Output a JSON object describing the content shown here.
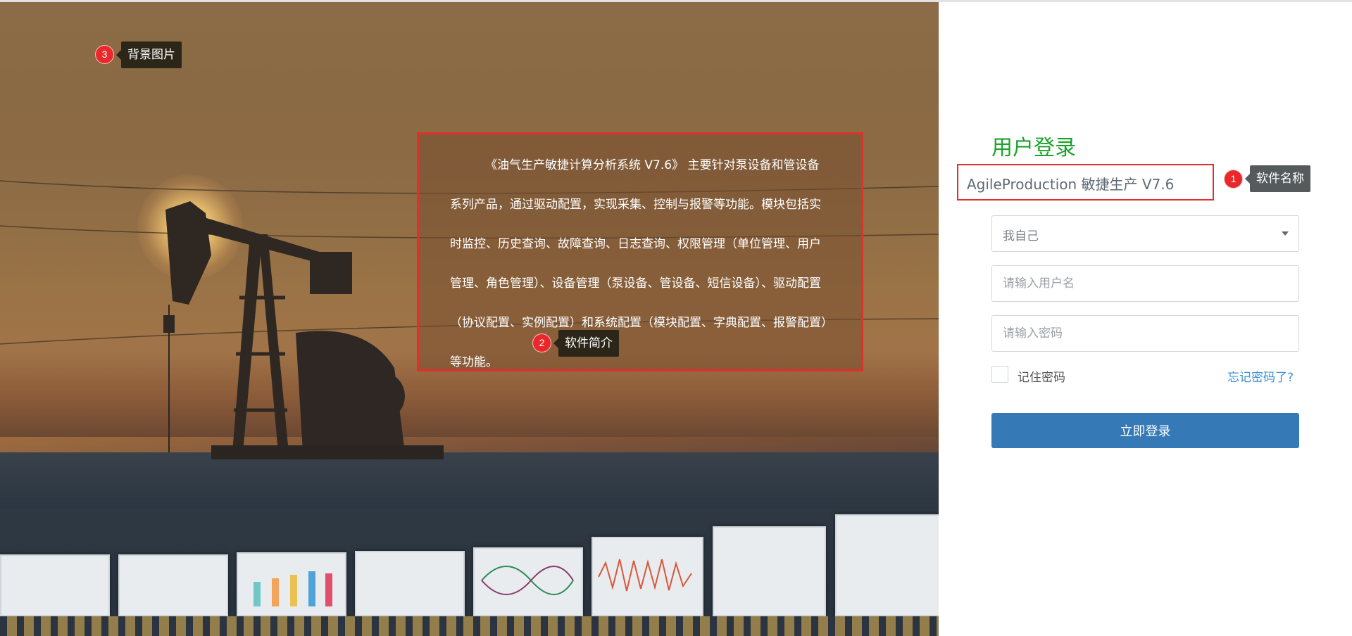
{
  "background": {
    "tooltip": {
      "badge": "3",
      "label": "背景图片"
    }
  },
  "intro": {
    "text": "《油气生产敏捷计算分析系统 V7.6》 主要针对泵设备和管设备系列产品，通过驱动配置，实现采集、控制与报警等功能。模块包括实时监控、历史查询、故障查询、日志查询、权限管理（单位管理、用户管理、角色管理）、设备管理（泵设备、管设备、短信设备）、驱动配置（协议配置、实例配置）和系统配置（模块配置、字典配置、报警配置）等功能。",
    "tooltip": {
      "badge": "2",
      "label": "软件简介"
    }
  },
  "login": {
    "title": "用户登录",
    "software_name": "AgileProduction 敏捷生产 V7.6",
    "name_tooltip": {
      "badge": "1",
      "label": "软件名称"
    },
    "org_select": {
      "value": "我自己"
    },
    "username": {
      "placeholder": "请输入用户名",
      "value": ""
    },
    "password": {
      "placeholder": "请输入密码",
      "value": ""
    },
    "remember": {
      "label": "记住密码",
      "checked": false
    },
    "forgot_link": "忘记密码了?",
    "submit": "立即登录"
  },
  "colors": {
    "title_green": "#1aa32a",
    "button_blue": "#3579b6",
    "link_blue": "#3d8fd6",
    "annotation_red": "#e0302e"
  }
}
